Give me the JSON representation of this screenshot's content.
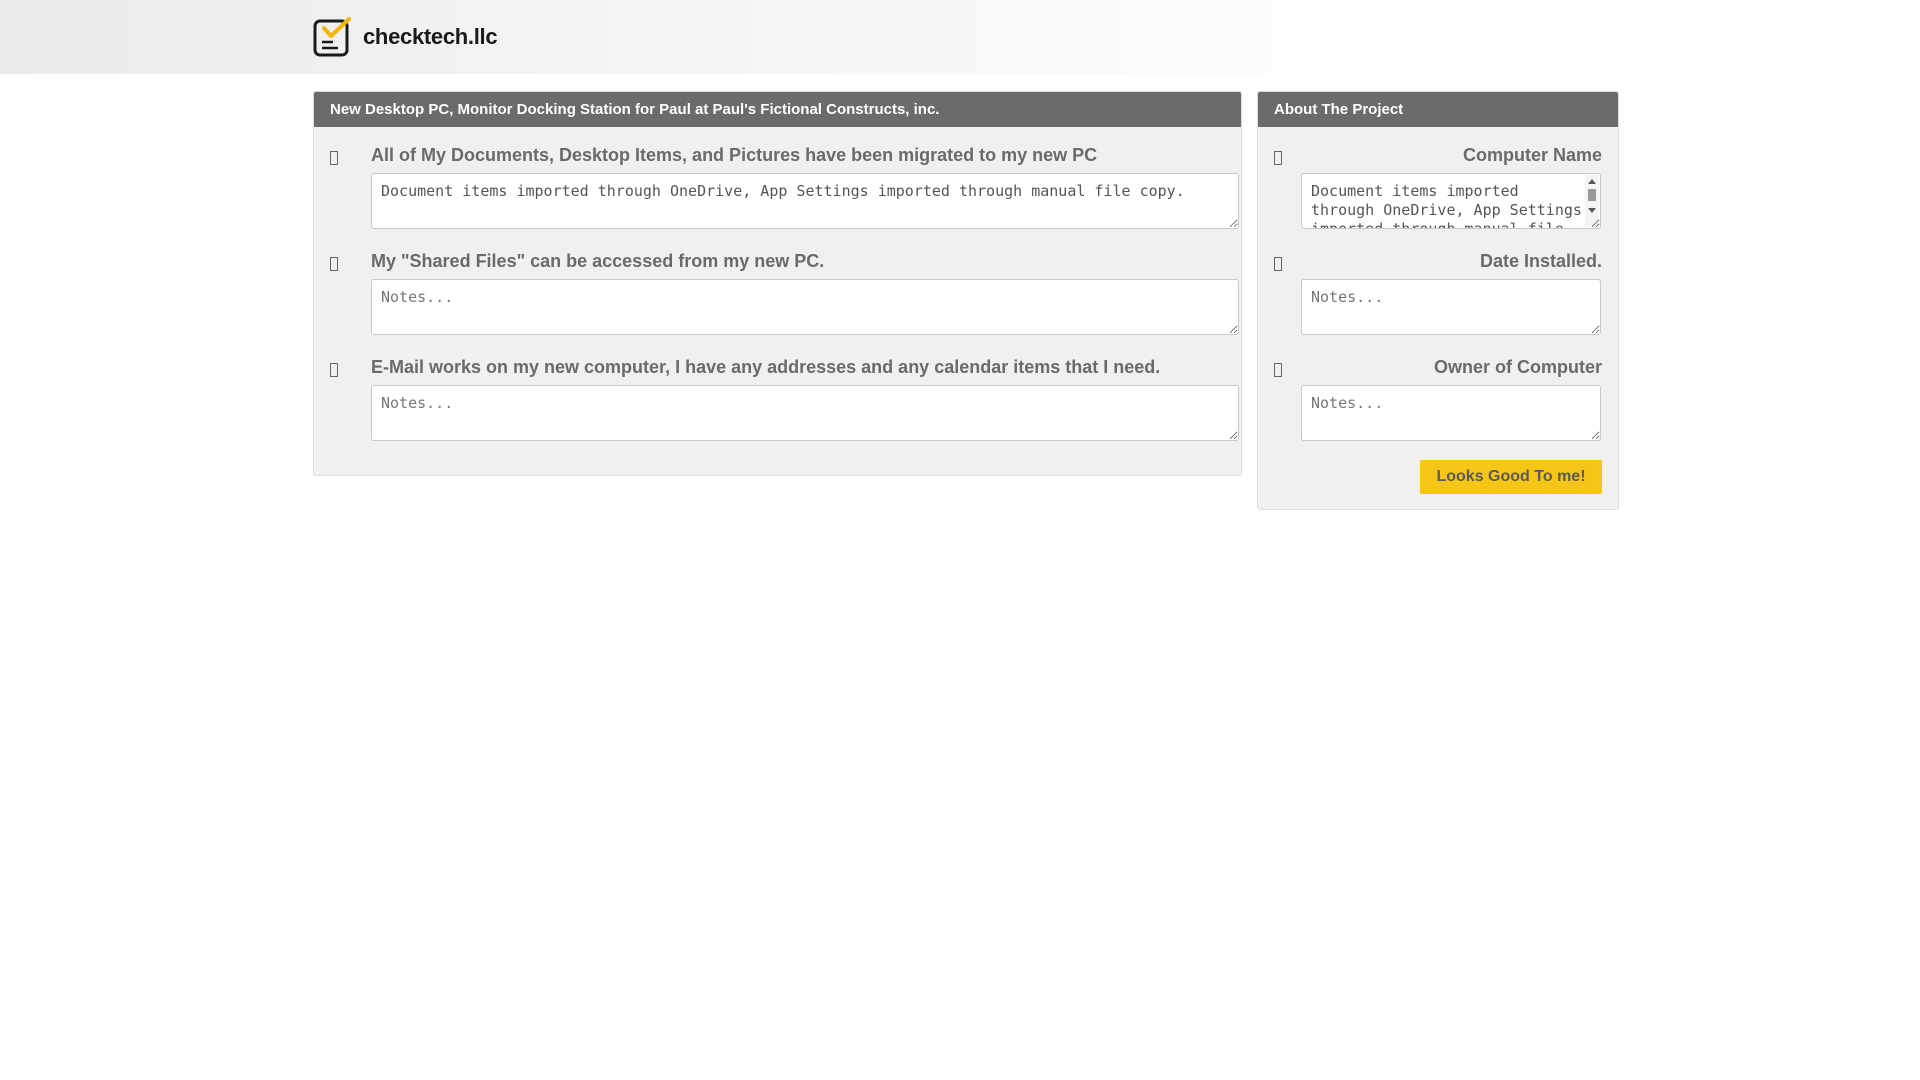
{
  "brand": {
    "name": "checktech.llc"
  },
  "project": {
    "title": "New Desktop PC, Monitor Docking Station for Paul at Paul's Fictional Constructs, inc.",
    "items": [
      {
        "label": "All of My Documents, Desktop Items, and Pictures have been migrated to my new PC",
        "note_value": "Document items imported through OneDrive, App Settings imported through manual file copy.",
        "note_placeholder": "Notes..."
      },
      {
        "label": "My \"Shared Files\" can be accessed from my new PC.",
        "note_value": "",
        "note_placeholder": "Notes..."
      },
      {
        "label": "E-Mail works on my new computer, I have any addresses and any calendar items that I need.",
        "note_value": "",
        "note_placeholder": "Notes..."
      }
    ]
  },
  "about": {
    "title": "About The Project",
    "items": [
      {
        "label": "Computer Name",
        "note_value": "Document items imported through OneDrive, App Settings imported through manual file copy.",
        "note_placeholder": "Notes..."
      },
      {
        "label": "Date Installed.",
        "note_value": "",
        "note_placeholder": "Notes..."
      },
      {
        "label": "Owner of Computer",
        "note_value": "",
        "note_placeholder": "Notes..."
      }
    ],
    "confirm_label": "Looks Good To me!"
  },
  "colors": {
    "header_bg": "#6b6b6b",
    "accent": "#f5c518",
    "logo_accent": "#f2b705"
  },
  "icons": {
    "logo": "checklist-clipboard-icon",
    "item_check": "checkbox-icon"
  }
}
